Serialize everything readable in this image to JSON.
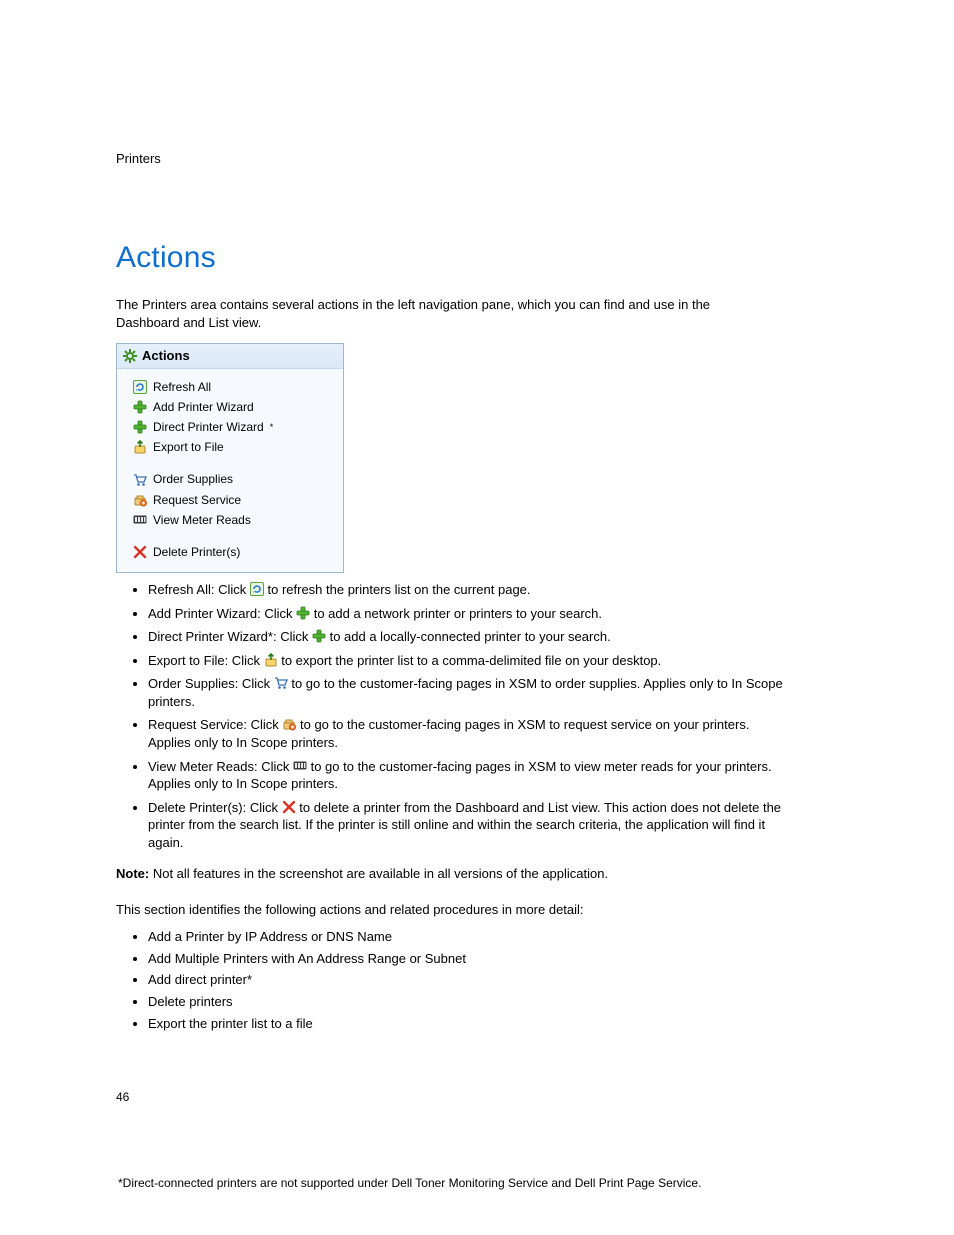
{
  "header": {
    "section": "Printers"
  },
  "title": "Actions",
  "intro": "The Printers area contains several actions in the left navigation pane, which you can find and use in the Dashboard and List view.",
  "panel": {
    "heading": "Actions",
    "groups": [
      {
        "items": [
          {
            "name": "refresh-all",
            "label": "Refresh All",
            "icon": "refresh-icon"
          },
          {
            "name": "add-printer",
            "label": "Add Printer Wizard",
            "icon": "plus-icon"
          },
          {
            "name": "direct-printer",
            "label": "Direct Printer Wizard",
            "icon": "plus-icon",
            "sup": "*"
          },
          {
            "name": "export-file",
            "label": "Export to File",
            "icon": "export-icon"
          }
        ]
      },
      {
        "items": [
          {
            "name": "order-supplies",
            "label": "Order Supplies",
            "icon": "cart-icon"
          },
          {
            "name": "request-service",
            "label": "Request Service",
            "icon": "service-icon"
          },
          {
            "name": "view-meter",
            "label": "View Meter Reads",
            "icon": "meter-icon"
          }
        ]
      },
      {
        "items": [
          {
            "name": "delete-printers",
            "label": "Delete Printer(s)",
            "icon": "delete-icon"
          }
        ]
      }
    ]
  },
  "bullets": [
    {
      "lead": "Refresh All: Click ",
      "icon": "refresh-icon",
      "tail": " to refresh the printers list on the current page."
    },
    {
      "lead": "Add Printer Wizard: Click ",
      "icon": "plus-icon",
      "tail": " to add a network printer or printers to your search."
    },
    {
      "lead": "Direct Printer Wizard*: Click ",
      "icon": "plus-icon",
      "tail": " to add a locally-connected printer to your search."
    },
    {
      "lead": "Export to File: Click ",
      "icon": "export-icon",
      "tail": " to export the printer list to a comma-delimited file on your desktop."
    },
    {
      "lead": "Order Supplies: Click ",
      "icon": "cart-icon",
      "tail": " to go to the customer-facing pages in XSM to order supplies. Applies only to In Scope printers."
    },
    {
      "lead": "Request Service: Click ",
      "icon": "service-icon",
      "tail": " to go to the customer-facing pages in XSM to request service on your printers. Applies only to In Scope printers."
    },
    {
      "lead": "View Meter Reads: Click ",
      "icon": "meter-icon",
      "tail": " to go to the customer-facing pages in XSM to view meter reads for your printers. Applies only to In Scope printers."
    },
    {
      "lead": "Delete Printer(s): Click ",
      "icon": "delete-icon",
      "tail": " to delete a printer from the Dashboard and List view. This action does not delete the printer from the search list. If the printer is still online and within the search criteria, the application will find it again."
    }
  ],
  "note_label": "Note:",
  "note_text": " Not all features in the screenshot are available in all versions of the application.",
  "following_intro": "This section identifies the following actions and related procedures in more detail:",
  "following_list": [
    "Add a Printer by IP Address or DNS Name",
    "Add Multiple Printers with An Address Range or Subnet",
    "Add direct printer*",
    "Delete printers",
    "Export the printer list to a file"
  ],
  "page_number": "46",
  "footnote": "*Direct-connected printers are not supported under Dell Toner Monitoring Service and Dell Print Page Service."
}
